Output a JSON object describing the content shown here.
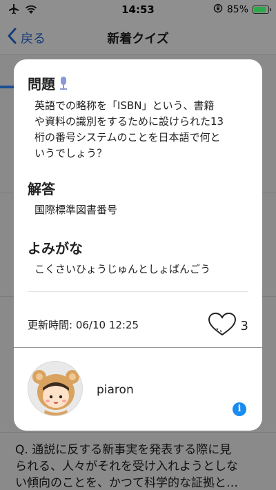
{
  "statusbar": {
    "time": "14:53",
    "battery": "85%",
    "battery_level": 0.85
  },
  "nav": {
    "back_label": "戻る",
    "title": "新着クイズ"
  },
  "card": {
    "question_heading": "問題",
    "question_lines": [
      "英語での略称を「ISBN」という、書籍",
      "や資料の識別をするために設けられた13",
      "桁の番号システムのことを日本語で何と",
      "いうでしょう？"
    ],
    "answer_heading": "解答",
    "answer": "国際標準図書番号",
    "reading_heading": "よみがな",
    "reading": "こくさいひょうじゅんとしょばんごう",
    "updated": "更新時間: 06/10 12:25",
    "likes": "3",
    "username": "piaron",
    "info_icon": "i"
  },
  "background_preview": {
    "lines": [
      "Q. 通説に反する新事実を発表する際に見",
      "られる、人々がそれを受け入れようとしな",
      "い傾向のことを、かつて科学的な証拠と…"
    ]
  },
  "colors": {
    "accent": "#1a8cf0",
    "nav_tint": "#173b7a",
    "battery": "#2fa84a"
  }
}
